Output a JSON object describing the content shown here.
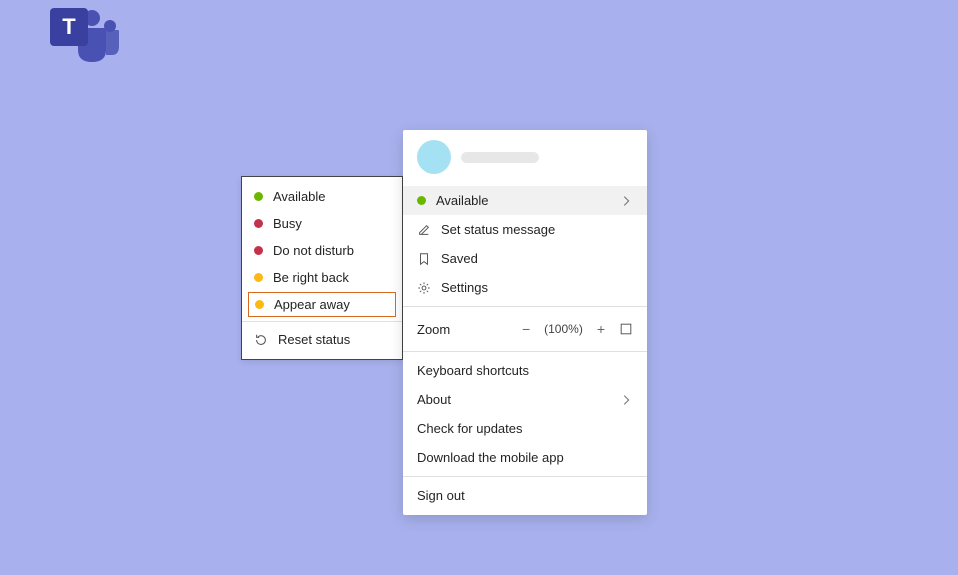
{
  "statusMenu": {
    "items": [
      {
        "label": "Available",
        "dotClass": "dot-available"
      },
      {
        "label": "Busy",
        "dotClass": "dot-busy"
      },
      {
        "label": "Do not disturb",
        "dotClass": "dot-dnd"
      },
      {
        "label": "Be right back",
        "dotClass": "dot-brb"
      },
      {
        "label": "Appear away",
        "dotClass": "dot-away"
      }
    ],
    "reset": "Reset status"
  },
  "profileMenu": {
    "status": "Available",
    "setStatus": "Set status message",
    "saved": "Saved",
    "settings": "Settings",
    "zoomLabel": "Zoom",
    "zoomValue": "(100%)",
    "keyboard": "Keyboard shortcuts",
    "about": "About",
    "check": "Check for updates",
    "download": "Download the mobile app",
    "signOut": "Sign out"
  }
}
